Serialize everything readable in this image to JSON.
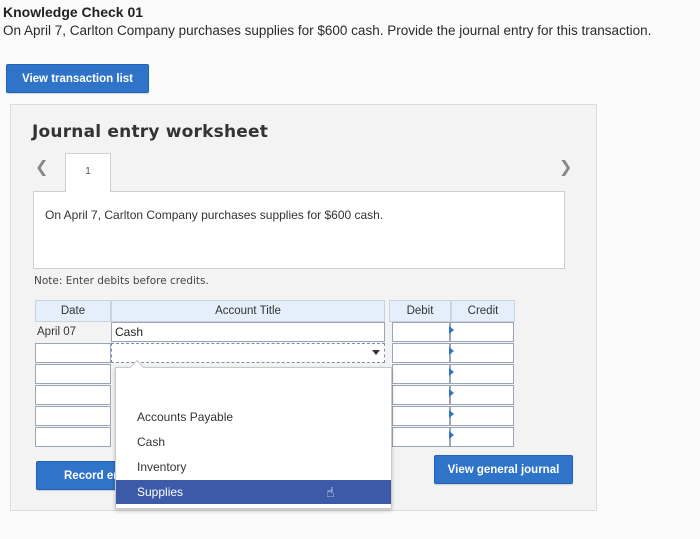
{
  "header": {
    "title": "Knowledge Check 01",
    "question": "On April 7, Carlton Company purchases supplies for $600 cash. Provide the journal entry for this transaction."
  },
  "buttons": {
    "view_transaction_list": "View transaction list",
    "record_entry": "Record er",
    "view_general_journal": "View general journal"
  },
  "worksheet": {
    "title": "Journal entry worksheet",
    "tab_number": "1",
    "description": "On April 7, Carlton Company purchases supplies for $600 cash.",
    "note": "Note: Enter debits before credits.",
    "columns": {
      "date": "Date",
      "account_title": "Account Title",
      "debit": "Debit",
      "credit": "Credit"
    },
    "rows": [
      {
        "date": "April 07",
        "account": "Cash",
        "debit": "",
        "credit": ""
      }
    ]
  },
  "dropdown": {
    "options": [
      "Accounts Payable",
      "Cash",
      "Inventory",
      "Supplies"
    ],
    "selected": "Supplies"
  },
  "colors": {
    "button_blue": "#2f74c9",
    "header_bg": "#e5eefb",
    "selected_option": "#3d5aa8"
  },
  "icons": {
    "prev": "chevron-left-icon",
    "next": "chevron-right-icon",
    "cursor": "hand-cursor-icon"
  }
}
